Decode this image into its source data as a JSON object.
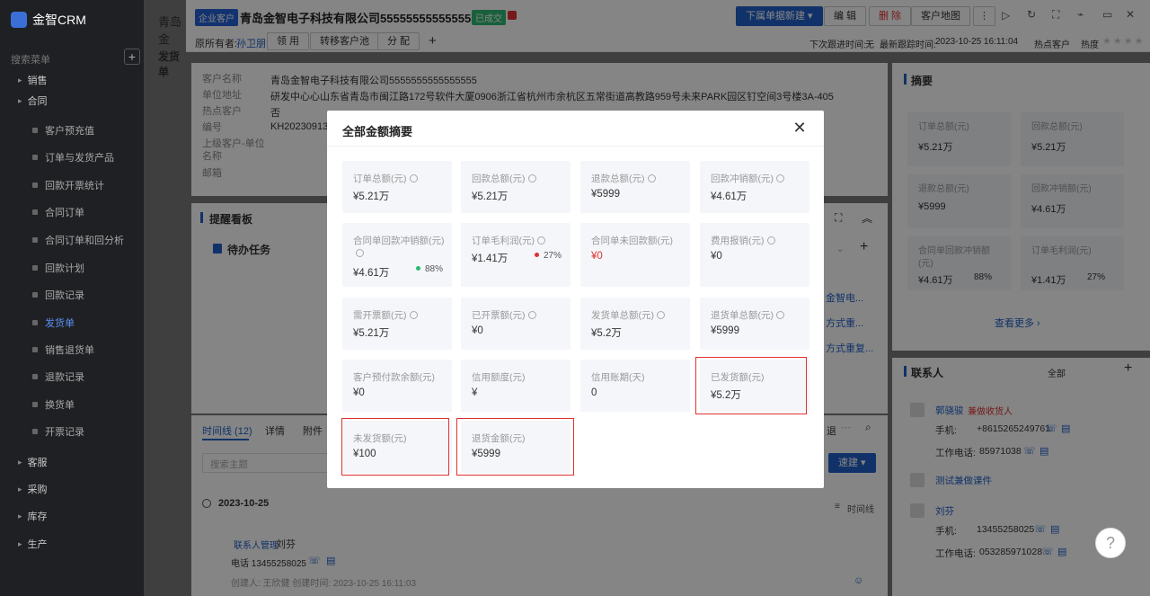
{
  "app": {
    "name": "金智CRM",
    "search_placeholder": "搜索菜单"
  },
  "sidebar": {
    "items": [
      {
        "label": "销售",
        "type": "group"
      },
      {
        "label": "合同",
        "type": "group"
      },
      {
        "label": "客户预充值",
        "type": "sub"
      },
      {
        "label": "订单与发货产品",
        "type": "sub"
      },
      {
        "label": "回款开票统计",
        "type": "sub"
      },
      {
        "label": "合同订单",
        "type": "sub"
      },
      {
        "label": "合同订单和回分析",
        "type": "sub"
      },
      {
        "label": "回款计划",
        "type": "sub"
      },
      {
        "label": "回款记录",
        "type": "sub"
      },
      {
        "label": "发货单",
        "type": "sub",
        "active": true
      },
      {
        "label": "销售退货单",
        "type": "sub"
      },
      {
        "label": "退款记录",
        "type": "sub"
      },
      {
        "label": "换货单",
        "type": "sub"
      },
      {
        "label": "开票记录",
        "type": "sub"
      },
      {
        "label": "客服",
        "type": "group"
      },
      {
        "label": "采购",
        "type": "group"
      },
      {
        "label": "库存",
        "type": "group"
      },
      {
        "label": "生产",
        "type": "group"
      }
    ]
  },
  "background_page": {
    "tab_title": "青岛金",
    "section_title": "发货单"
  },
  "record": {
    "type_badge": "企业客户",
    "name": "青岛金智电子科技有限公司5555555555555555",
    "status": "已成交",
    "buttons": {
      "new": "下属单据新建",
      "edit": "编 辑",
      "delete": "删 除",
      "map": "客户地图"
    },
    "owner_label": "原所有者:",
    "owner_name": "孙卫朋",
    "owner_buttons": [
      "领 用",
      "转移客户池",
      "分 配"
    ],
    "next_follow_label": "下次跟进时间:",
    "next_follow_value": "无",
    "last_follow_label": "最新跟踪时间:",
    "last_follow_value": "2023-10-25 16:11:04",
    "hot_label": "热点客户",
    "heat_label": "热度"
  },
  "info": {
    "fields": [
      {
        "label": "客户名称",
        "value": "青岛金智电子科技有限公司5555555555555555"
      },
      {
        "label": "单位地址",
        "value": "研发中心心山东省青岛市闽江路172号软件大厦0906浙江省杭州市余杭区五常街道高教路959号未来PARK园区钉空间3号楼3A-405"
      },
      {
        "label": "热点客户",
        "value": "否"
      },
      {
        "label": "编号",
        "value": "KH2023091310"
      },
      {
        "label": "上级客户-单位名称",
        "value": ""
      },
      {
        "label": "邮箱",
        "value": ""
      }
    ]
  },
  "board": {
    "title": "提醒看板",
    "todo": "待办任务",
    "links": [
      "金智电...",
      "方式重...",
      "方式重复..."
    ]
  },
  "timeline": {
    "tabs": [
      "时间线 (12)",
      "详情",
      "附件"
    ],
    "search_placeholder": "搜索主题",
    "quick_btn": "速建",
    "date": "2023-10-25",
    "view_label": "时间线",
    "entry_tag": "联系人管理",
    "entry_name": "刘芬",
    "entry_phone": "电话 13455258025",
    "entry_meta": "创建人: 王欣健   创建时间: 2023-10-25 16:11:03"
  },
  "summary": {
    "title": "摘要",
    "tiles": [
      {
        "label": "订单总额(元)",
        "value": "¥5.21万"
      },
      {
        "label": "回款总额(元)",
        "value": "¥5.21万"
      },
      {
        "label": "退款总额(元)",
        "value": "¥5999"
      },
      {
        "label": "回款冲销额(元)",
        "value": "¥4.61万"
      },
      {
        "label": "合同单回款冲销额(元)",
        "value": "¥4.61万",
        "pct": "88%"
      },
      {
        "label": "订单毛利润(元)",
        "value": "¥1.41万",
        "pct": "27%"
      }
    ],
    "more": "查看更多"
  },
  "contacts": {
    "title": "联系人",
    "filter": "全部",
    "list": [
      {
        "name": "郭骁骏",
        "tag": "兼做收货人",
        "mobile_label": "手机:",
        "mobile": "+8615265249761",
        "work_label": "工作电话:",
        "work": "85971038"
      },
      {
        "name": "测试兼做课件",
        "tag": "",
        "mobile_label": "",
        "mobile": "",
        "work_label": "",
        "work": ""
      },
      {
        "name": "刘芬",
        "tag": "",
        "mobile_label": "手机:",
        "mobile": "13455258025",
        "work_label": "工作电话:",
        "work": "053285971028"
      }
    ]
  },
  "modal": {
    "title": "全部金额摘要",
    "cards": [
      {
        "label": "订单总额(元)",
        "value": "¥5.21万",
        "clock": true
      },
      {
        "label": "回款总额(元)",
        "value": "¥5.21万",
        "clock": true
      },
      {
        "label": "退款总额(元)",
        "value": "¥5999",
        "clock": true
      },
      {
        "label": "回款冲销额(元)",
        "value": "¥4.61万",
        "clock": true
      },
      {
        "label": "合同单回款冲销额(元)",
        "value": "¥4.61万",
        "clock": true,
        "pct": "88%",
        "pct_color": "#2eb872"
      },
      {
        "label": "订单毛利润(元)",
        "value": "¥1.41万",
        "clock": true,
        "pct": "27%",
        "pct_color": "#e03030"
      },
      {
        "label": "合同单未回款额(元)",
        "value": "¥0",
        "clock": false,
        "red": true
      },
      {
        "label": "费用报销(元)",
        "value": "¥0",
        "clock": true
      },
      {
        "label": "需开票额(元)",
        "value": "¥5.21万",
        "clock": true
      },
      {
        "label": "已开票额(元)",
        "value": "¥0",
        "clock": true
      },
      {
        "label": "发货单总额(元)",
        "value": "¥5.2万",
        "clock": true
      },
      {
        "label": "退货单总额(元)",
        "value": "¥5999",
        "clock": true
      },
      {
        "label": "客户预付款余额(元)",
        "value": "¥0",
        "clock": false
      },
      {
        "label": "信用额度(元)",
        "value": "¥",
        "clock": false
      },
      {
        "label": "信用账期(天)",
        "value": "0",
        "clock": false
      },
      {
        "label": "已发货额(元)",
        "value": "¥5.2万",
        "clock": false,
        "highlight": true
      },
      {
        "label": "未发货额(元)",
        "value": "¥100",
        "clock": false,
        "highlight": true
      },
      {
        "label": "退货金额(元)",
        "value": "¥5999",
        "clock": false,
        "highlight": true
      }
    ]
  },
  "colors": {
    "accent": "#2160c9",
    "danger": "#e03030",
    "success": "#2eb872",
    "highlight_border": "#e0312f"
  }
}
